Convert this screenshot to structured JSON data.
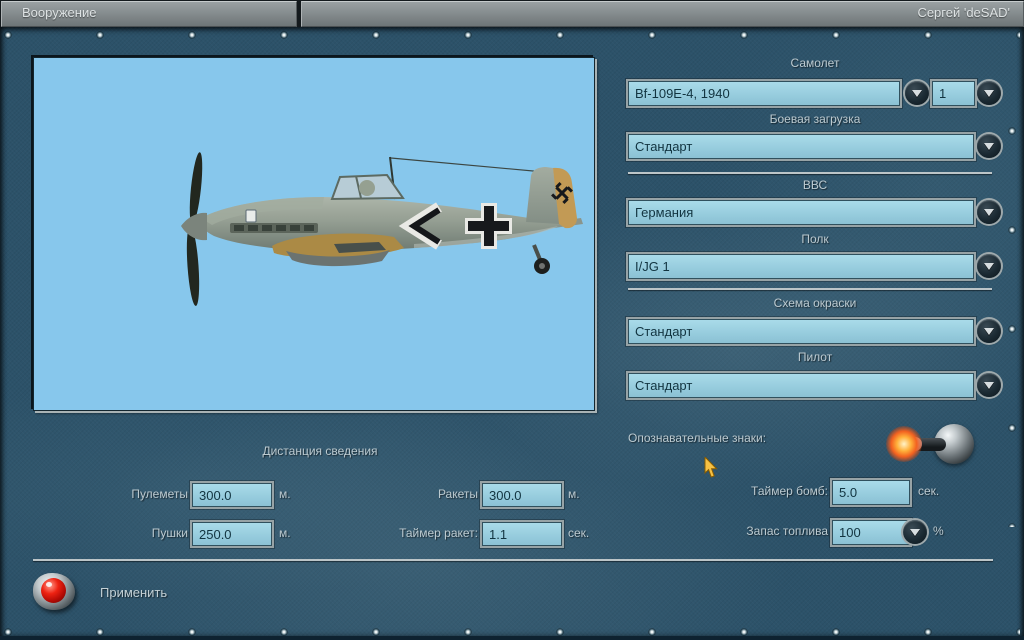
{
  "titlebar": {
    "title": "Вооружение",
    "player": "Сергей 'deSAD'"
  },
  "form": {
    "aircraft": {
      "label": "Самолет",
      "value": "Bf-109E-4, 1940",
      "count": "1"
    },
    "loadout": {
      "label": "Боевая загрузка",
      "value": "Стандарт"
    },
    "airforce": {
      "label": "ВВС",
      "value": "Германия"
    },
    "regiment": {
      "label": "Полк",
      "value": "I/JG 1"
    },
    "paint_scheme": {
      "label": "Схема окраски",
      "value": "Стандарт"
    },
    "pilot": {
      "label": "Пилот",
      "value": "Стандарт"
    },
    "markings_label": "Опознавательные знаки:"
  },
  "convergence": {
    "title": "Дистанция сведения",
    "machineguns": {
      "label": "Пулеметы",
      "value": "300.0",
      "unit": "м."
    },
    "cannons": {
      "label": "Пушки",
      "value": "250.0",
      "unit": "м."
    },
    "rockets": {
      "label": "Ракеты",
      "value": "300.0",
      "unit": "м."
    },
    "rocket_timer": {
      "label": "Таймер ракет:",
      "value": "1.1",
      "unit": "сек."
    }
  },
  "timers": {
    "bomb_timer": {
      "label": "Таймер бомб:",
      "value": "5.0",
      "unit": "сек."
    },
    "fuel": {
      "label": "Запас топлива",
      "value": "100",
      "unit": "%"
    }
  },
  "apply_label": "Применить",
  "colors": {
    "panel_teal": "#2c5269",
    "field_blue": "#9ccfe0",
    "sky_blue": "#87c7ec",
    "titlebar_gray": "#868d8f",
    "button_red": "#ee2212",
    "glow_orange": "#f26120"
  }
}
